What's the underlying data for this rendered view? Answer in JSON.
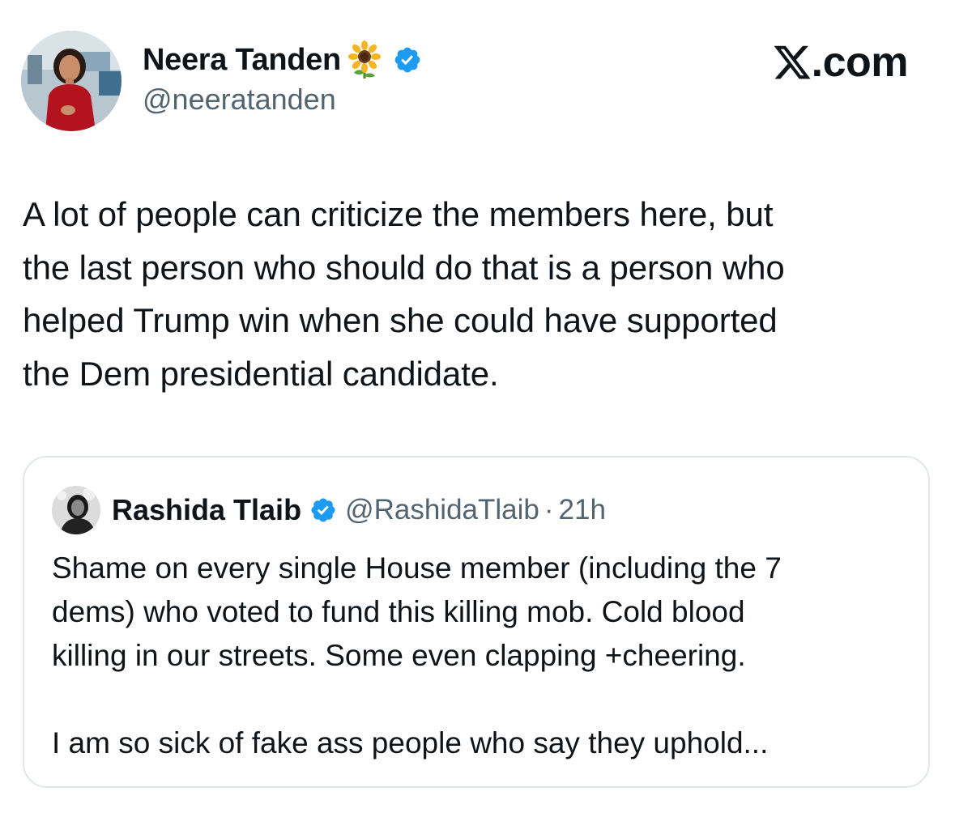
{
  "post": {
    "author": {
      "name": "Neera Tanden",
      "handle": "@neeratanden",
      "emoji": "sunflower-emoji",
      "verified": true,
      "avatar": "avatar-photo-woman-red-dress"
    },
    "brand": {
      "logo": "x-logo-icon",
      "text": ".com"
    },
    "text": "A lot of people can criticize the members here, but\nthe last person who should do that is a person who\nhelped Trump win when she could have supported\nthe Dem presidential candidate.",
    "quote": {
      "author": {
        "name": "Rashida Tlaib",
        "handle": "@RashidaTlaib",
        "verified": true,
        "avatar": "avatar-photo-woman-black-white"
      },
      "separator": "·",
      "time": "21h",
      "text": "Shame on every single House member (including the 7\ndems) who voted to fund this killing mob. Cold blood\nkilling in our streets. Some even clapping +cheering.\n\nI am so sick of fake ass people who say they uphold..."
    }
  },
  "colors": {
    "text_primary": "#0f1419",
    "text_secondary": "#536471",
    "verified_blue": "#1d9bf0",
    "card_border": "#e1e8ed",
    "background": "#ffffff"
  }
}
